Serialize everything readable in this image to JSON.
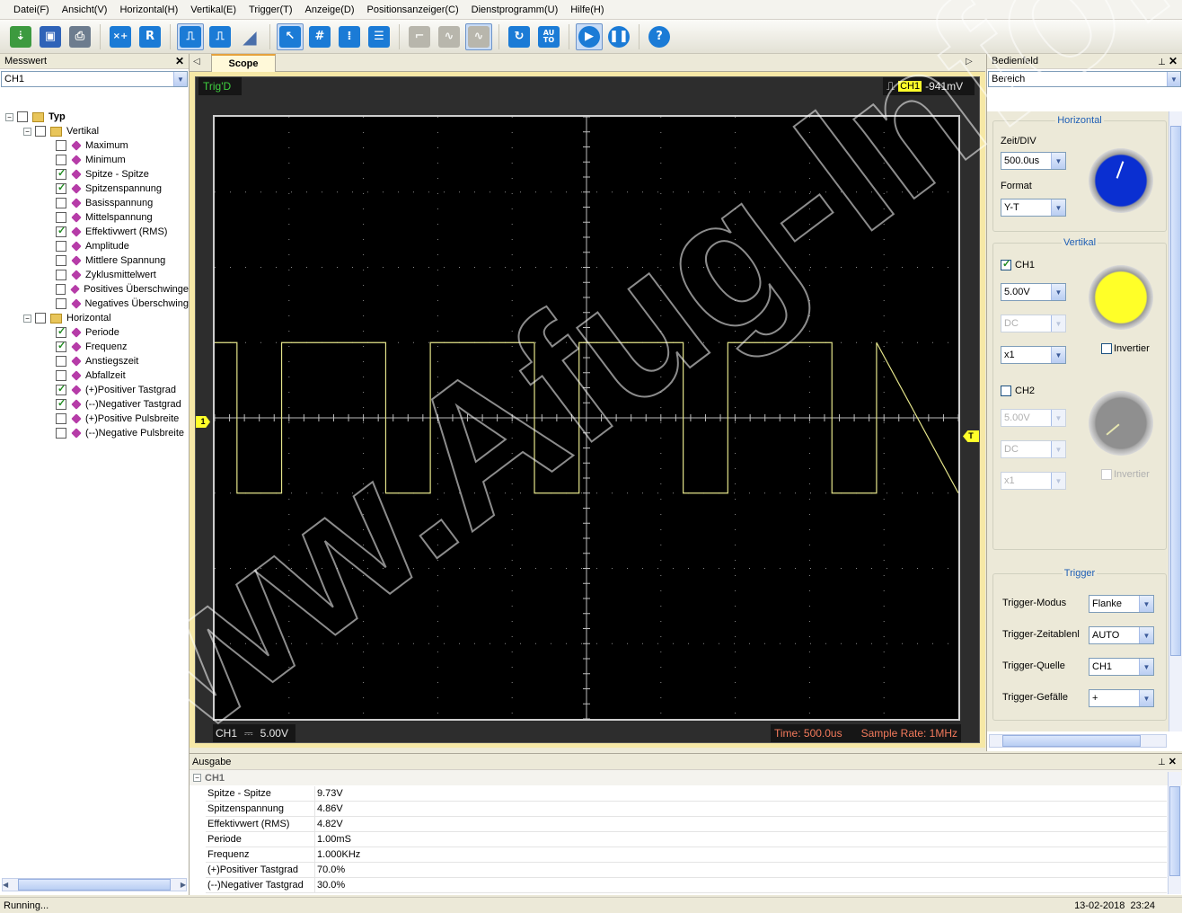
{
  "menu": [
    "Datei(F)",
    "Ansicht(V)",
    "Horizontal(H)",
    "Vertikal(E)",
    "Trigger(T)",
    "Anzeige(D)",
    "Positionsanzeiger(C)",
    "Dienstprogramm(U)",
    "Hilfe(H)"
  ],
  "toolbar_icons": [
    "open-icon",
    "save-icon",
    "print-icon",
    "measure-add-icon",
    "reference-icon",
    "pulse-icon",
    "ramp-icon",
    "triangle-icon",
    "cursor-icon",
    "grid-icon",
    "vertical-lines-icon",
    "dashed-lines-icon",
    "step-icon",
    "sine-gray-icon",
    "sine-icon",
    "refresh-icon",
    "auto-icon",
    "run-icon",
    "pause-icon",
    "help-icon"
  ],
  "toolbar_text": {
    "reference": "R",
    "auto": "AU\nTO",
    "help": "?"
  },
  "left_panel": {
    "title": "Messwert",
    "channel": "CH1",
    "tree": {
      "root": "Typ",
      "vertical_label": "Vertikal",
      "vertical_items": [
        {
          "label": "Maximum",
          "checked": false
        },
        {
          "label": "Minimum",
          "checked": false
        },
        {
          "label": "Spitze - Spitze",
          "checked": true
        },
        {
          "label": "Spitzenspannung",
          "checked": true
        },
        {
          "label": "Basisspannung",
          "checked": false
        },
        {
          "label": "Mittelspannung",
          "checked": false
        },
        {
          "label": "Effektivwert (RMS)",
          "checked": true
        },
        {
          "label": "Amplitude",
          "checked": false
        },
        {
          "label": "Mittlere Spannung",
          "checked": false
        },
        {
          "label": "Zyklusmittelwert",
          "checked": false
        },
        {
          "label": "Positives Überschwinge",
          "checked": false
        },
        {
          "label": "Negatives Überschwing",
          "checked": false
        }
      ],
      "horizontal_label": "Horizontal",
      "horizontal_items": [
        {
          "label": "Periode",
          "checked": true
        },
        {
          "label": "Frequenz",
          "checked": true
        },
        {
          "label": "Anstiegszeit",
          "checked": false
        },
        {
          "label": "Abfallzeit",
          "checked": false
        },
        {
          "label": "(+)Positiver Tastgrad",
          "checked": true
        },
        {
          "label": "(--)Negativer Tastgrad",
          "checked": true
        },
        {
          "label": "(+)Positive Pulsbreite",
          "checked": false
        },
        {
          "label": "(--)Negative Pulsbreite",
          "checked": false
        }
      ]
    }
  },
  "scope": {
    "tab_label": "Scope",
    "trig_status": "Trig'D",
    "trig_channel": "CH1",
    "trig_level": "-941mV",
    "ch_marker": "1",
    "trig_marker": "T",
    "bottom_channel": "CH1",
    "bottom_coupling": "⎓",
    "bottom_volts": "5.00V",
    "time": "Time: 500.0us",
    "sample_rate": "Sample Rate: 1MHz",
    "grid": {
      "h_divisions": 10,
      "v_divisions": 8
    },
    "waveform": {
      "type": "square",
      "frequency_hz": 1000,
      "duty_positive": 0.7,
      "high_div": 1.0,
      "low_div": -1.0,
      "time_per_div_us": 500
    },
    "trace_color": "#e4e48a",
    "watermark": "www.Afug-Info.de"
  },
  "right_panel": {
    "title": "Bedienfeld",
    "combo": "Bereich",
    "horizontal": {
      "title": "Horizontal",
      "zeit_label": "Zeit/DIV",
      "zeit_value": "500.0us",
      "format_label": "Format",
      "format_value": "Y-T"
    },
    "vertical": {
      "title": "Vertikal",
      "ch1_label": "CH1",
      "ch1_volts": "5.00V",
      "ch1_coupling": "DC",
      "ch1_probe": "x1",
      "invert_label": "Invertier",
      "ch2_label": "CH2",
      "ch2_volts": "5.00V",
      "ch2_coupling": "DC",
      "ch2_probe": "x1",
      "invert2_label": "Invertier"
    },
    "trigger": {
      "title": "Trigger",
      "modus_label": "Trigger-Modus",
      "modus_value": "Flanke",
      "zeit_label": "Trigger-Zeitablenl",
      "zeit_value": "AUTO",
      "quelle_label": "Trigger-Quelle",
      "quelle_value": "CH1",
      "gefaelle_label": "Trigger-Gefälle",
      "gefaelle_value": "+"
    },
    "colors": {
      "horizontal_knob": "#0a2fd1",
      "ch1_knob": "#ffff28",
      "ch2_knob": "#8f8f8f"
    }
  },
  "output": {
    "title": "Ausgabe",
    "channel": "CH1",
    "rows": [
      {
        "k": "Spitze - Spitze",
        "v": "9.73V"
      },
      {
        "k": "Spitzenspannung",
        "v": "4.86V"
      },
      {
        "k": "Effektivwert (RMS)",
        "v": "4.82V"
      },
      {
        "k": "Periode",
        "v": "1.00mS"
      },
      {
        "k": "Frequenz",
        "v": "1.000KHz"
      },
      {
        "k": "(+)Positiver Tastgrad",
        "v": "70.0%"
      },
      {
        "k": "(--)Negativer Tastgrad",
        "v": "30.0%"
      }
    ]
  },
  "status": {
    "left": "Running...",
    "date": "13-02-2018",
    "time": "23:24"
  }
}
